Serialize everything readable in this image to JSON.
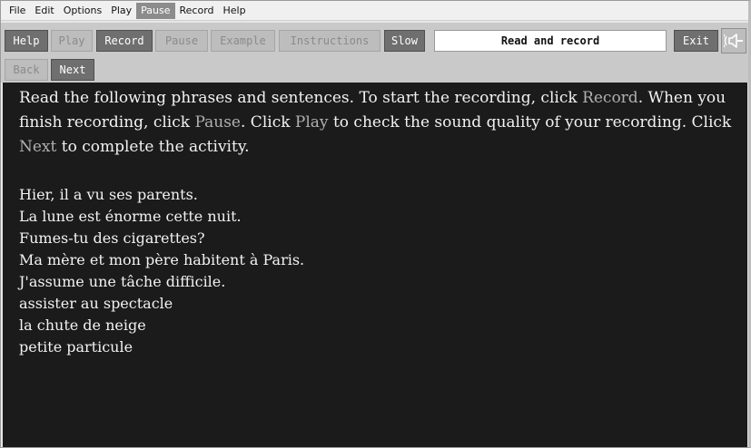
{
  "menu": [
    "File",
    "Edit",
    "Options",
    "Play",
    "Pause",
    "Record",
    "Help"
  ],
  "menu_active": "Pause",
  "toolbar": {
    "help": "Help",
    "play": "Play",
    "record": "Record",
    "pause": "Pause",
    "example": "Example",
    "instructions": "Instructions",
    "slow": "Slow",
    "title": "Read and record",
    "exit": "Exit",
    "speaker_icon": "speaker-icon"
  },
  "nav": {
    "back": "Back",
    "next": "Next"
  },
  "instructions": {
    "p1": "Read the following phrases and sentences. To start the recording, click ",
    "k1": "Record",
    "p2": ". When you finish recording, click ",
    "k2": "Pause",
    "p3": ". Click ",
    "k3": "Play",
    "p4": " to check the sound quality of your recording. Click ",
    "k4": "Next",
    "p5": " to complete the activity."
  },
  "phrases": [
    "Hier, il a vu ses parents.",
    "La lune est énorme cette nuit.",
    "Fumes-tu des cigarettes?",
    "Ma mère et mon père habitent à Paris.",
    "J'assume une tâche difficile.",
    "assister au spectacle",
    "la chute de neige",
    "petite particule"
  ],
  "colors": {
    "content_bg": "#1b1b1b",
    "content_text": "#f2f2f2",
    "keyword_text": "#b0b0b0",
    "button_enabled": "#6f6f6f",
    "button_disabled": "#bdbdbd"
  }
}
